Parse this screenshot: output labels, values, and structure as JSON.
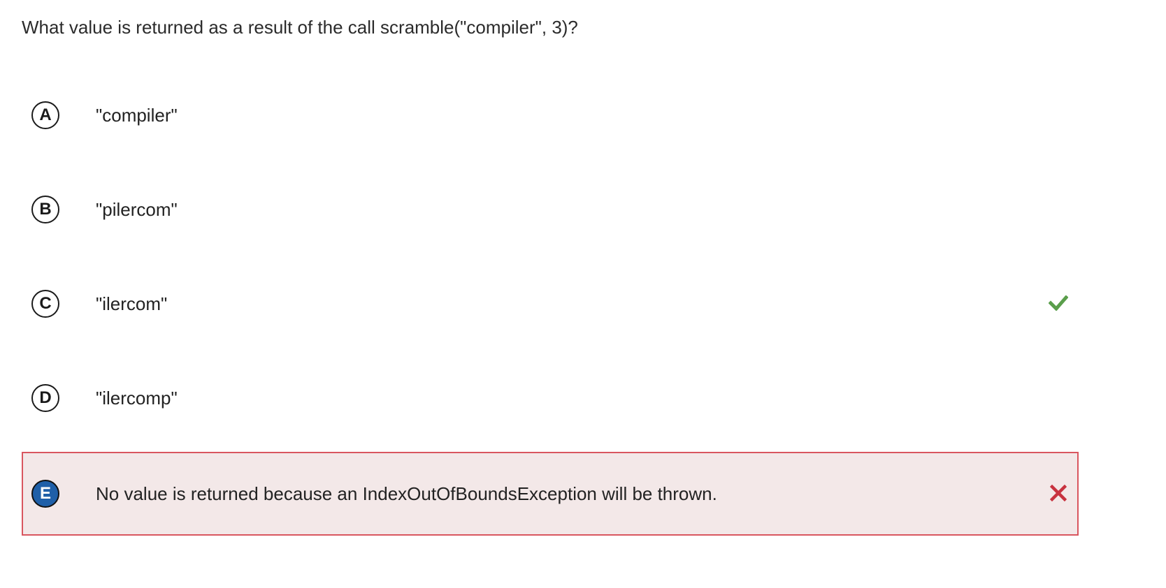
{
  "question": {
    "text": "What value is returned as a result of the call scramble(\"compiler\", 3)?"
  },
  "options": [
    {
      "letter": "A",
      "text": "\"compiler\"",
      "state": "none"
    },
    {
      "letter": "B",
      "text": "\"pilercom\"",
      "state": "none"
    },
    {
      "letter": "C",
      "text": "\"ilercom\"",
      "state": "correct"
    },
    {
      "letter": "D",
      "text": "\"ilercomp\"",
      "state": "none"
    },
    {
      "letter": "E",
      "text": "No value is returned because an IndexOutOfBoundsException will be thrown.",
      "state": "selected-incorrect"
    }
  ],
  "icons": {
    "correct": "checkmark-icon",
    "incorrect": "x-mark-icon"
  },
  "colors": {
    "correct": "#5a9e4b",
    "incorrect": "#c8323f",
    "selected_background": "#f3e8e8",
    "selected_border": "#d9565f",
    "selected_letter_fill": "#1f5fa8"
  }
}
